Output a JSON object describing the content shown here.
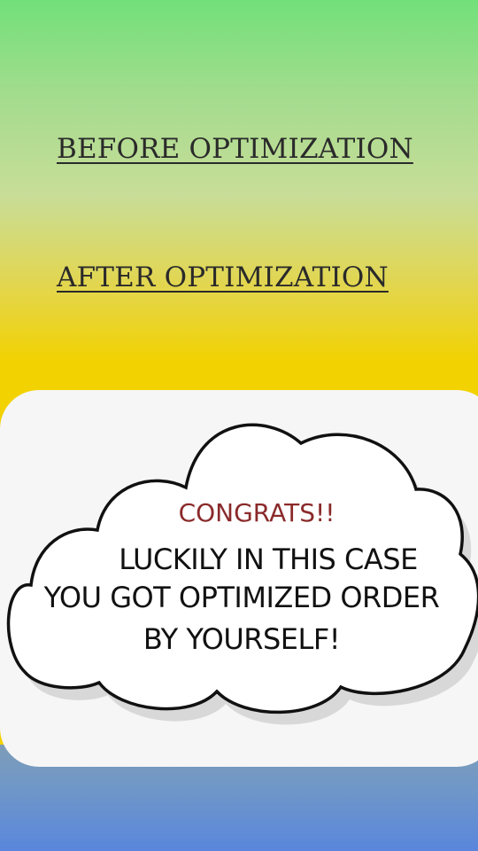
{
  "links": {
    "before_label": "BEFORE OPTIMIZATION",
    "after_label": "AFTER OPTIMIZATION"
  },
  "dialog": {
    "title": "CONGRATS!!",
    "lines": [
      "LUCKILY IN THIS CASE",
      "YOU GOT OPTIMIZED ORDER",
      "BY YOURSELF!"
    ]
  },
  "colors": {
    "top_green": "#72e07a",
    "yellow": "#f2d200",
    "panel_bg": "#f6f6f6",
    "title_red": "#8a2a2a",
    "bottom_blue": "#5a86dc"
  }
}
